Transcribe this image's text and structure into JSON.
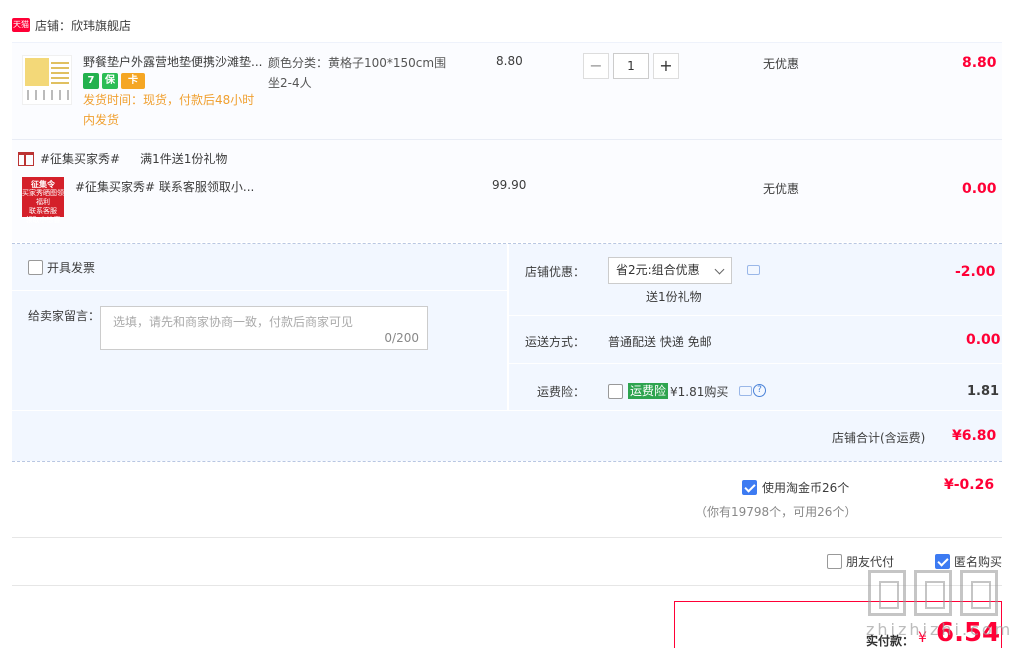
{
  "shop": {
    "badge": "天猫",
    "label": "店铺：欣玮旗舰店"
  },
  "item1": {
    "title": "野餐垫户外露营地垫便携沙滩垫...",
    "tags": [
      "7",
      "保",
      "卡"
    ],
    "ship_note": "发货时间：现货，付款后48小时内发货",
    "sku": "颜色分类：黄格子100*150cm围坐2-4人",
    "price": "8.80",
    "qty_minus": "−",
    "qty": "1",
    "qty_plus": "+",
    "discount": "无优惠",
    "total": "8.80"
  },
  "gift": {
    "name": "#征集买家秀#",
    "rule": "满1件送1份礼物",
    "thumb_title": "征集令",
    "thumb_line1": "买家秀晒图领福利",
    "thumb_line2": "联系客服",
    "thumb_line3": "领取小惊喜",
    "title": "#征集买家秀# 联系客服领取小...",
    "price": "99.90",
    "discount": "无优惠",
    "total": "0.00"
  },
  "options": {
    "invoice_label": "开具发票",
    "message_label": "给卖家留言：",
    "message_placeholder": "选填，请先和商家协商一致，付款后商家可见",
    "message_count": "0/200",
    "coupon_label": "店铺优惠：",
    "coupon_value": "省2元:组合优惠",
    "coupon_gift": "送1份礼物",
    "coupon_amount": "-2.00",
    "shipping_label": "运送方式：",
    "shipping_method": "普通配送 快递 免邮",
    "shipping_amount": "0.00",
    "insurance_label": "运费险：",
    "insurance_tag": "运费险",
    "insurance_price": "¥1.81购买",
    "insurance_amount": "1.81"
  },
  "subtotal": {
    "label": "店铺合计(含运费)",
    "amount": "¥6.80"
  },
  "coins": {
    "label": "使用淘金币26个",
    "amount": "¥-0.26",
    "note": "（你有19798个，可用26个）"
  },
  "extras": {
    "friend_pay": "朋友代付",
    "anonymous": "匿名购买"
  },
  "payment": {
    "label": "实付款：",
    "currency": "¥",
    "amount": "6.54"
  },
  "watermark": {
    "text": "zhizhizhi.com"
  }
}
